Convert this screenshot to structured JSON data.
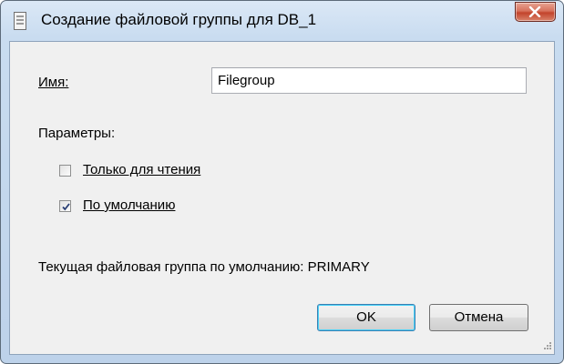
{
  "window": {
    "title": "Создание файловой группы для DB_1",
    "close_icon": "close-icon",
    "app_icon": "database-icon"
  },
  "form": {
    "name_label": "Имя:",
    "name_value": "Filegroup",
    "params_label": "Параметры:",
    "readonly_label": "Только для чтения",
    "readonly_checked": false,
    "default_label": "По умолчанию",
    "default_checked": true,
    "current_default_text": "Текущая файловая группа по умолчанию: PRIMARY"
  },
  "buttons": {
    "ok_label": "OK",
    "cancel_label": "Отмена"
  },
  "colors": {
    "frame": "#bdd2ea",
    "client": "#f0f0f0",
    "close_button": "#c3442c",
    "default_button_border": "#3c7fb1"
  }
}
